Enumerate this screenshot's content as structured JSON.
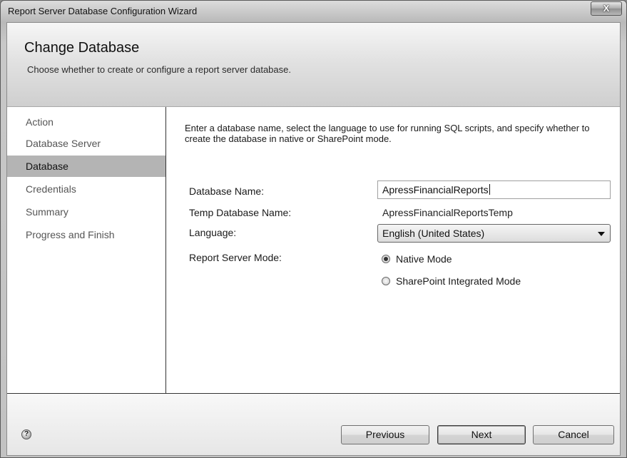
{
  "window": {
    "title": "Report Server Database Configuration Wizard",
    "close_glyph": "X"
  },
  "header": {
    "title": "Change Database",
    "subtitle": "Choose whether to create or configure a report server database."
  },
  "nav": {
    "items": [
      {
        "label": "Action"
      },
      {
        "label": "Database Server"
      },
      {
        "label": "Database",
        "selected": true
      },
      {
        "label": "Credentials"
      },
      {
        "label": "Summary"
      },
      {
        "label": "Progress and Finish"
      }
    ]
  },
  "main": {
    "description": "Enter a database name, select the language to use for running SQL scripts, and specify whether to create the database in native or SharePoint mode.",
    "database_name_label": "Database Name:",
    "database_name_value": "ApressFinancialReports",
    "temp_database_label": "Temp Database Name:",
    "temp_database_value": "ApressFinancialReportsTemp",
    "language_label": "Language:",
    "language_value": "English (United States)",
    "mode_label": "Report Server Mode:",
    "modes": [
      {
        "label": "Native Mode",
        "selected": true
      },
      {
        "label": "SharePoint Integrated Mode",
        "selected": false
      }
    ]
  },
  "footer": {
    "help_glyph": "?",
    "previous_label": "Previous",
    "next_label": "Next",
    "cancel_label": "Cancel"
  }
}
